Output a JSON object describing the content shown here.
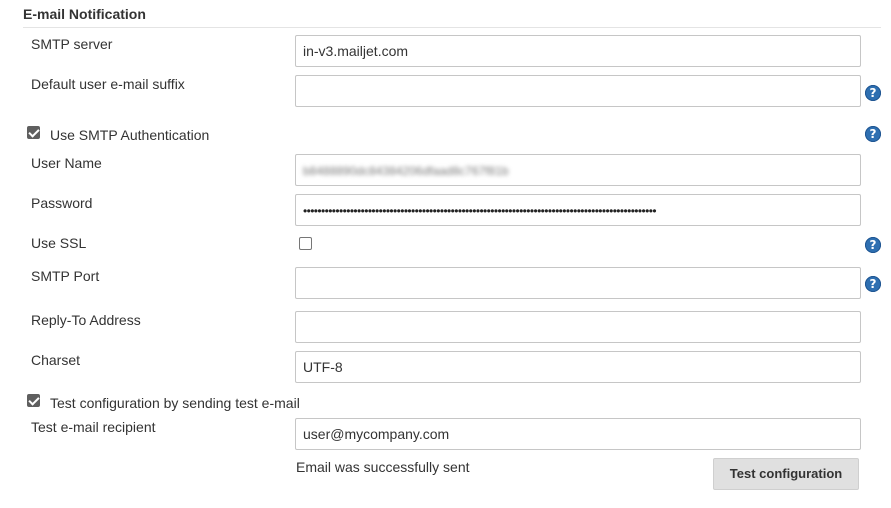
{
  "section": {
    "title": "E-mail Notification"
  },
  "smtp_server": {
    "label": "SMTP server",
    "value": "in-v3.mailjet.com"
  },
  "default_suffix": {
    "label": "Default user e-mail suffix",
    "value": ""
  },
  "use_smtp_auth": {
    "label": "Use SMTP Authentication",
    "checked": true
  },
  "user_name": {
    "label": "User Name",
    "value": "b8488890dc84384206dfaad8c767f81b"
  },
  "password": {
    "label": "Password",
    "value": "••••••••••••••••••••••••••••••••••••••••••••••••••••••••••••••••••••••••••••••••••••••••••••••••••"
  },
  "use_ssl": {
    "label": "Use SSL",
    "checked": false
  },
  "smtp_port": {
    "label": "SMTP Port",
    "value": ""
  },
  "reply_to": {
    "label": "Reply-To Address",
    "value": ""
  },
  "charset": {
    "label": "Charset",
    "value": "UTF-8"
  },
  "test_config": {
    "label": "Test configuration by sending test e-mail",
    "checked": true
  },
  "test_recipient": {
    "label": "Test e-mail recipient",
    "value": "user@mycompany.com"
  },
  "status_message": "Email was successfully sent",
  "test_button": {
    "label": "Test configuration"
  },
  "help_icon_glyph": "?",
  "colors": {
    "help_icon": "#2e6fb1",
    "button_bg": "#e0e0e0",
    "border": "#c6c6c6"
  }
}
